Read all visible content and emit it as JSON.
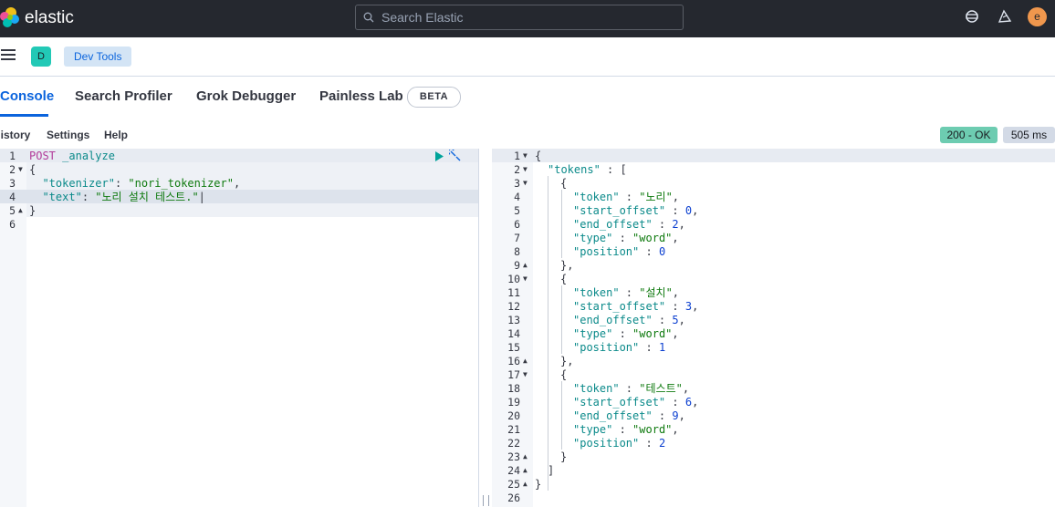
{
  "header": {
    "brand": "elastic",
    "search_placeholder": "Search Elastic",
    "avatar_initial": "e"
  },
  "nav": {
    "space_initial": "D",
    "breadcrumb": "Dev Tools"
  },
  "tabs": [
    {
      "label": "Console",
      "active": true
    },
    {
      "label": "Search Profiler"
    },
    {
      "label": "Grok Debugger"
    },
    {
      "label": "Painless Lab"
    }
  ],
  "beta_badge": "BETA",
  "toolbar": {
    "history": "History",
    "settings": "Settings",
    "help": "Help"
  },
  "status": {
    "code": "200 - OK",
    "time": "505 ms"
  },
  "request": {
    "method": "POST",
    "endpoint": "_analyze",
    "tokenizer_key": "\"tokenizer\"",
    "tokenizer_value": "\"nori_tokenizer\"",
    "text_key": "\"text\"",
    "text_value": "\"노리 설치 테스트.\"",
    "line_numbers": [
      "1",
      "2",
      "3",
      "4",
      "5",
      "6"
    ]
  },
  "response": {
    "tokens": [
      {
        "token": "\"노리\"",
        "start_offset": "0",
        "end_offset": "2",
        "type": "\"word\"",
        "position": "0"
      },
      {
        "token": "\"설치\"",
        "start_offset": "3",
        "end_offset": "5",
        "type": "\"word\"",
        "position": "1"
      },
      {
        "token": "\"테스트\"",
        "start_offset": "6",
        "end_offset": "9",
        "type": "\"word\"",
        "position": "2"
      }
    ],
    "line_numbers": [
      "1",
      "2",
      "3",
      "4",
      "5",
      "6",
      "7",
      "8",
      "9",
      "10",
      "11",
      "12",
      "13",
      "14",
      "15",
      "16",
      "17",
      "18",
      "19",
      "20",
      "21",
      "22",
      "23",
      "24",
      "25",
      "26"
    ]
  }
}
